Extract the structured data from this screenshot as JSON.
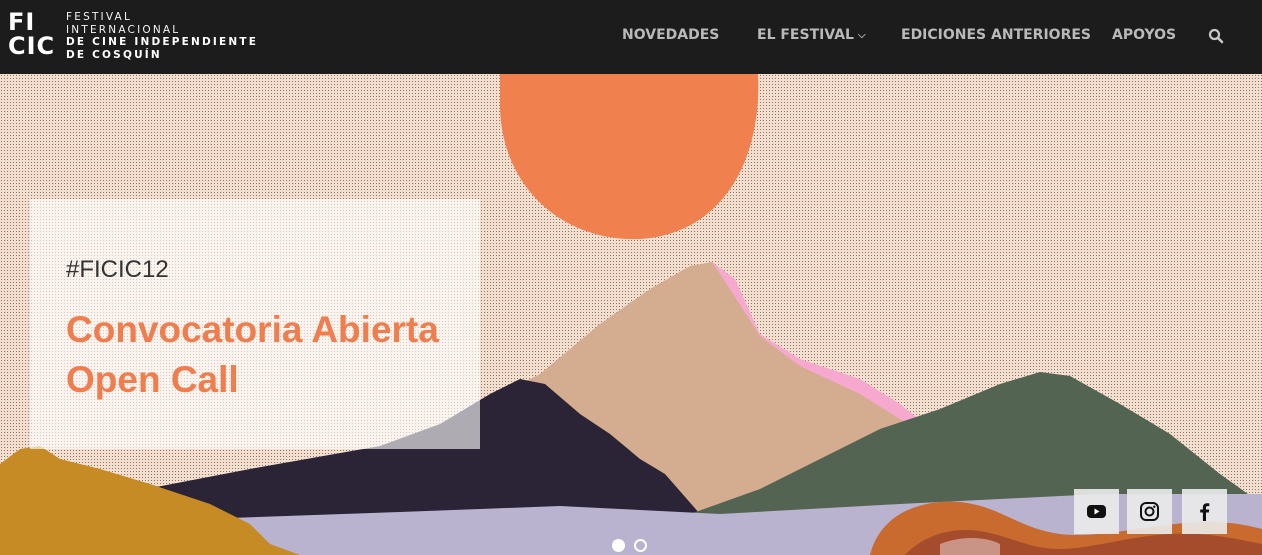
{
  "header": {
    "logo": {
      "mark_line1": "FI",
      "mark_line2": "CIC",
      "text_lines": [
        "FESTIVAL",
        "INTERNACIONAL",
        "DE CINE INDEPENDIENTE",
        "DE COSQUÍN"
      ]
    },
    "nav": [
      {
        "label": "NOVEDADES"
      },
      {
        "label": "EL FESTIVAL",
        "has_dropdown": true
      },
      {
        "label": "EDICIONES ANTERIORES"
      },
      {
        "label": "APOYOS"
      }
    ],
    "search_icon": "search-icon"
  },
  "hero": {
    "slide": {
      "tag": "#FICIC12",
      "title_line1": "Convocatoria Abierta",
      "title_line2": "Open Call"
    },
    "social": [
      {
        "icon": "youtube-icon"
      },
      {
        "icon": "instagram-icon"
      },
      {
        "icon": "facebook-icon"
      }
    ],
    "slider": {
      "total": 2,
      "active": 1
    }
  },
  "colors": {
    "header_bg": "#1c1c1c",
    "accent": "#ef7d4e",
    "sun": "#f0804e",
    "sky": "#f3dfcf"
  }
}
